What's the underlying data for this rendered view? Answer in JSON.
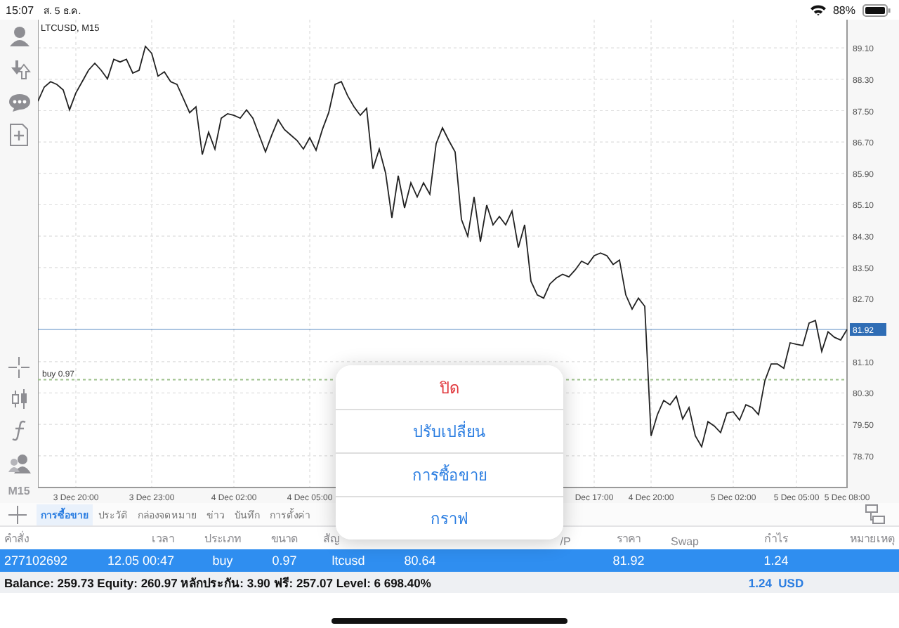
{
  "status_bar": {
    "time": "15:07",
    "date": "ส. 5 ธ.ค.",
    "battery": "88%"
  },
  "toolbar": {
    "timeframe": "M15"
  },
  "chart": {
    "chart_data": {
      "type": "line",
      "title": "LTCUSD, M15",
      "series": [
        {
          "color": "#222222",
          "values": [
            87.74,
            88.1,
            88.24,
            88.17,
            88.03,
            87.52,
            87.95,
            88.24,
            88.53,
            88.71,
            88.53,
            88.31,
            88.81,
            88.74,
            88.81,
            88.46,
            88.53,
            89.14,
            88.96,
            88.38,
            88.49,
            88.24,
            88.17,
            87.81,
            87.45,
            87.6,
            86.38,
            86.95,
            86.52,
            87.31,
            87.42,
            87.38,
            87.31,
            87.52,
            87.31,
            86.88,
            86.45,
            86.88,
            87.27,
            87.02,
            86.88,
            86.74,
            86.52,
            86.81,
            86.49,
            87.02,
            87.45,
            88.17,
            88.24,
            87.88,
            87.6,
            87.38,
            87.56,
            86.02,
            86.52,
            85.91,
            84.77,
            85.84,
            85.02,
            85.66,
            85.3,
            85.66,
            85.37,
            86.66,
            87.06,
            86.74,
            86.45,
            84.73,
            84.3,
            85.3,
            84.16,
            85.09,
            84.59,
            84.8,
            84.59,
            84.94,
            84.01,
            84.59,
            83.15,
            82.8,
            82.72,
            83.08,
            83.23,
            83.33,
            83.26,
            83.44,
            83.66,
            83.58,
            83.8,
            83.87,
            83.8,
            83.58,
            83.69,
            82.8,
            82.44,
            82.72,
            82.51,
            79.21,
            79.75,
            80.11,
            80.0,
            80.22,
            79.64,
            79.93,
            79.21,
            78.93,
            79.57,
            79.46,
            79.29,
            79.79,
            79.82,
            79.61,
            80.0,
            79.93,
            79.75,
            80.61,
            81.04,
            81.04,
            80.93,
            81.58,
            81.54,
            81.51,
            82.08,
            82.15,
            81.36,
            81.86,
            81.72,
            81.65,
            81.92
          ]
        }
      ],
      "ylim": [
        77.89,
        89.82
      ],
      "grid": true,
      "categories": [
        null,
        null,
        null,
        null,
        null,
        null,
        "3 Dec 20:00",
        null,
        null,
        null,
        null,
        null,
        null,
        null,
        null,
        null,
        null,
        null,
        "3 Dec 23:00",
        null,
        null,
        null,
        null,
        null,
        null,
        null,
        null,
        null,
        null,
        null,
        null,
        "4 Dec 02:00",
        null,
        null,
        null,
        null,
        null,
        null,
        null,
        null,
        null,
        null,
        null,
        "4 Dec 05:00",
        null,
        null,
        null,
        null,
        null,
        null,
        null,
        null,
        null,
        null,
        null,
        null,
        null,
        null,
        null,
        null,
        null,
        null,
        null,
        null,
        null,
        null,
        null,
        null,
        null,
        null,
        null,
        null,
        null,
        null,
        null,
        null,
        null,
        null,
        null,
        null,
        null,
        null,
        null,
        null,
        null,
        null,
        null,
        null,
        "Dec 17:00",
        null,
        null,
        null,
        null,
        null,
        null,
        null,
        null,
        "4 Dec 20:00",
        null,
        null,
        null,
        null,
        null,
        null,
        null,
        null,
        null,
        null,
        null,
        null,
        "5 Dec 02:00",
        null,
        null,
        null,
        null,
        null,
        null,
        null,
        null,
        null,
        "5 Dec 05:00",
        null,
        null,
        null,
        null,
        null,
        null,
        null,
        "5 Dec 08:00"
      ],
      "yticks": [
        {
          "value": 78.7,
          "label": "78.70"
        },
        {
          "value": 79.5,
          "label": "79.50"
        },
        {
          "value": 80.3,
          "label": "80.30"
        },
        {
          "value": 81.1,
          "label": "81.10"
        },
        {
          "value": 82.7,
          "label": "82.70"
        },
        {
          "value": 83.5,
          "label": "83.50"
        },
        {
          "value": 84.3,
          "label": "84.30"
        },
        {
          "value": 85.1,
          "label": "85.10"
        },
        {
          "value": 85.9,
          "label": "85.90"
        },
        {
          "value": 86.7,
          "label": "86.70"
        },
        {
          "value": 87.5,
          "label": "87.50"
        },
        {
          "value": 88.3,
          "label": "88.30"
        },
        {
          "value": 89.1,
          "label": "89.10"
        }
      ],
      "ref_lines": [
        {
          "axis": "y",
          "value": 81.92,
          "label": "81.92",
          "color": "#2f6db5"
        },
        {
          "axis": "y",
          "value": 80.64,
          "label": "buy 0.97",
          "color": "#9cc08a"
        }
      ]
    }
  },
  "tabs": [
    {
      "label": "การซื้อขาย",
      "selected": true
    },
    {
      "label": "ประวัติ",
      "selected": false
    },
    {
      "label": "กล่องจดหมาย",
      "selected": false
    },
    {
      "label": "ข่าว",
      "selected": false
    },
    {
      "label": "บันทึก",
      "selected": false
    },
    {
      "label": "การตั้งค่า",
      "selected": false
    }
  ],
  "table": {
    "columns": [
      {
        "label": "คำสั่ง"
      },
      {
        "label": "เวลา"
      },
      {
        "label": "ประเภท"
      },
      {
        "label": "ขนาด"
      },
      {
        "label": "สัญ"
      },
      {},
      {},
      {
        "label": "/P"
      },
      {
        "label": "ราคา"
      },
      {
        "label": "Swap"
      },
      {
        "label": "กำไร"
      },
      {
        "label": "หมายเหตุ"
      }
    ],
    "rows": [
      {
        "selected": true,
        "cells": [
          "277102692",
          "12.05 00:47",
          "buy",
          "0.97",
          "ltcusd",
          "80.64",
          null,
          null,
          "81.92",
          null,
          "1.24",
          null
        ]
      }
    ]
  },
  "summary": {
    "text": "Balance: 259.73 Equity: 260.97 หลักประกัน: 3.90 ฟรี: 257.07 Level: 6 698.40%",
    "profit": "1.24  USD"
  },
  "popup_menu": {
    "items": [
      {
        "label": "ปิด",
        "kind": "destructive"
      },
      {
        "label": "ปรับเปลี่ยน",
        "kind": "default"
      },
      {
        "label": "การซื้อขาย",
        "kind": "default"
      },
      {
        "label": "กราฟ",
        "kind": "default"
      }
    ]
  }
}
